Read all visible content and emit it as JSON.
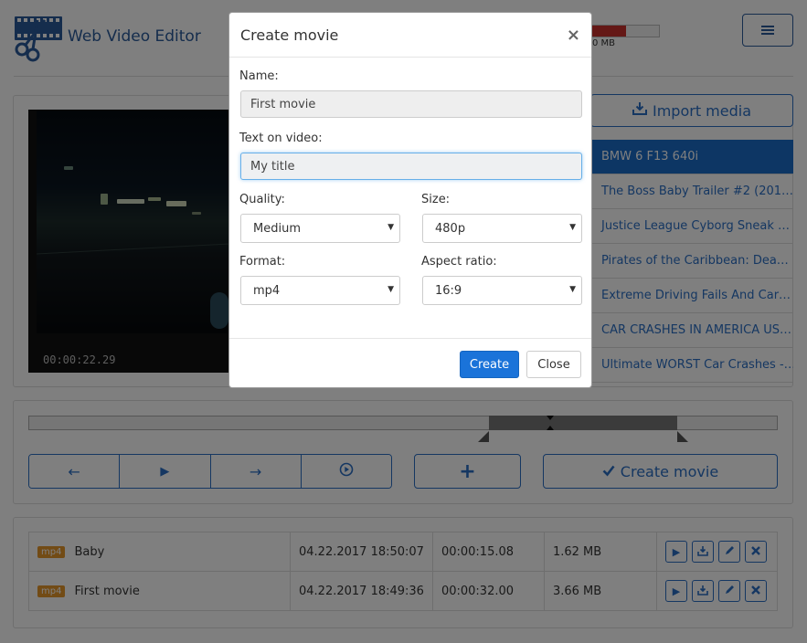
{
  "header": {
    "app_title": "Web Video Editor",
    "memory_text": "0 MB",
    "memory_usage_fraction": 0.55,
    "logo_icon": "film-scissors-icon",
    "menu_icon": "hamburger-icon"
  },
  "player": {
    "timecode": "00:00:22.29"
  },
  "media": {
    "import_label": "Import media",
    "import_icon": "import-icon",
    "items": [
      {
        "title": "BMW 6 F13 640i"
      },
      {
        "title": "The Boss Baby Trailer #2 (201…"
      },
      {
        "title": "Justice League Cyborg Sneak …"
      },
      {
        "title": "Pirates of the Caribbean: Dea…"
      },
      {
        "title": "Extreme Driving Fails And Car…"
      },
      {
        "title": "CAR CRASHES IN AMERICA US…"
      },
      {
        "title": "Ultimate WORST Car Crashes -…"
      }
    ],
    "active_index": 0
  },
  "timeline": {
    "buttons": [
      {
        "icon": "arrow-left-icon",
        "glyph": "←"
      },
      {
        "icon": "play-icon",
        "glyph": "▶"
      },
      {
        "icon": "arrow-right-icon",
        "glyph": "→"
      },
      {
        "icon": "play-circle-icon",
        "glyph": "▶"
      }
    ],
    "add_glyph": "+",
    "create_label": "Create movie",
    "selection_start_fraction": 0.615,
    "selection_end_fraction": 0.866
  },
  "movies": {
    "rows": [
      {
        "format": "mp4",
        "name": "Baby",
        "date": "04.22.2017 18:50:07",
        "duration": "00:00:15.08",
        "size": "1.62 MB"
      },
      {
        "format": "mp4",
        "name": "First movie",
        "date": "04.22.2017 18:49:36",
        "duration": "00:00:32.00",
        "size": "3.66 MB"
      }
    ],
    "action_icons": [
      "play-icon",
      "download-icon",
      "edit-icon",
      "delete-icon"
    ]
  },
  "modal": {
    "title": "Create movie",
    "close_glyph": "×",
    "name_label": "Name:",
    "name_value": "First movie",
    "text_label": "Text on video:",
    "text_value": "My title",
    "quality_label": "Quality:",
    "quality_value": "Medium",
    "size_label": "Size:",
    "size_value": "480p",
    "format_label": "Format:",
    "format_value": "mp4",
    "aspect_label": "Aspect ratio:",
    "aspect_value": "16:9",
    "create_label": "Create",
    "close_label": "Close",
    "primary_color": "#1a73d9"
  }
}
